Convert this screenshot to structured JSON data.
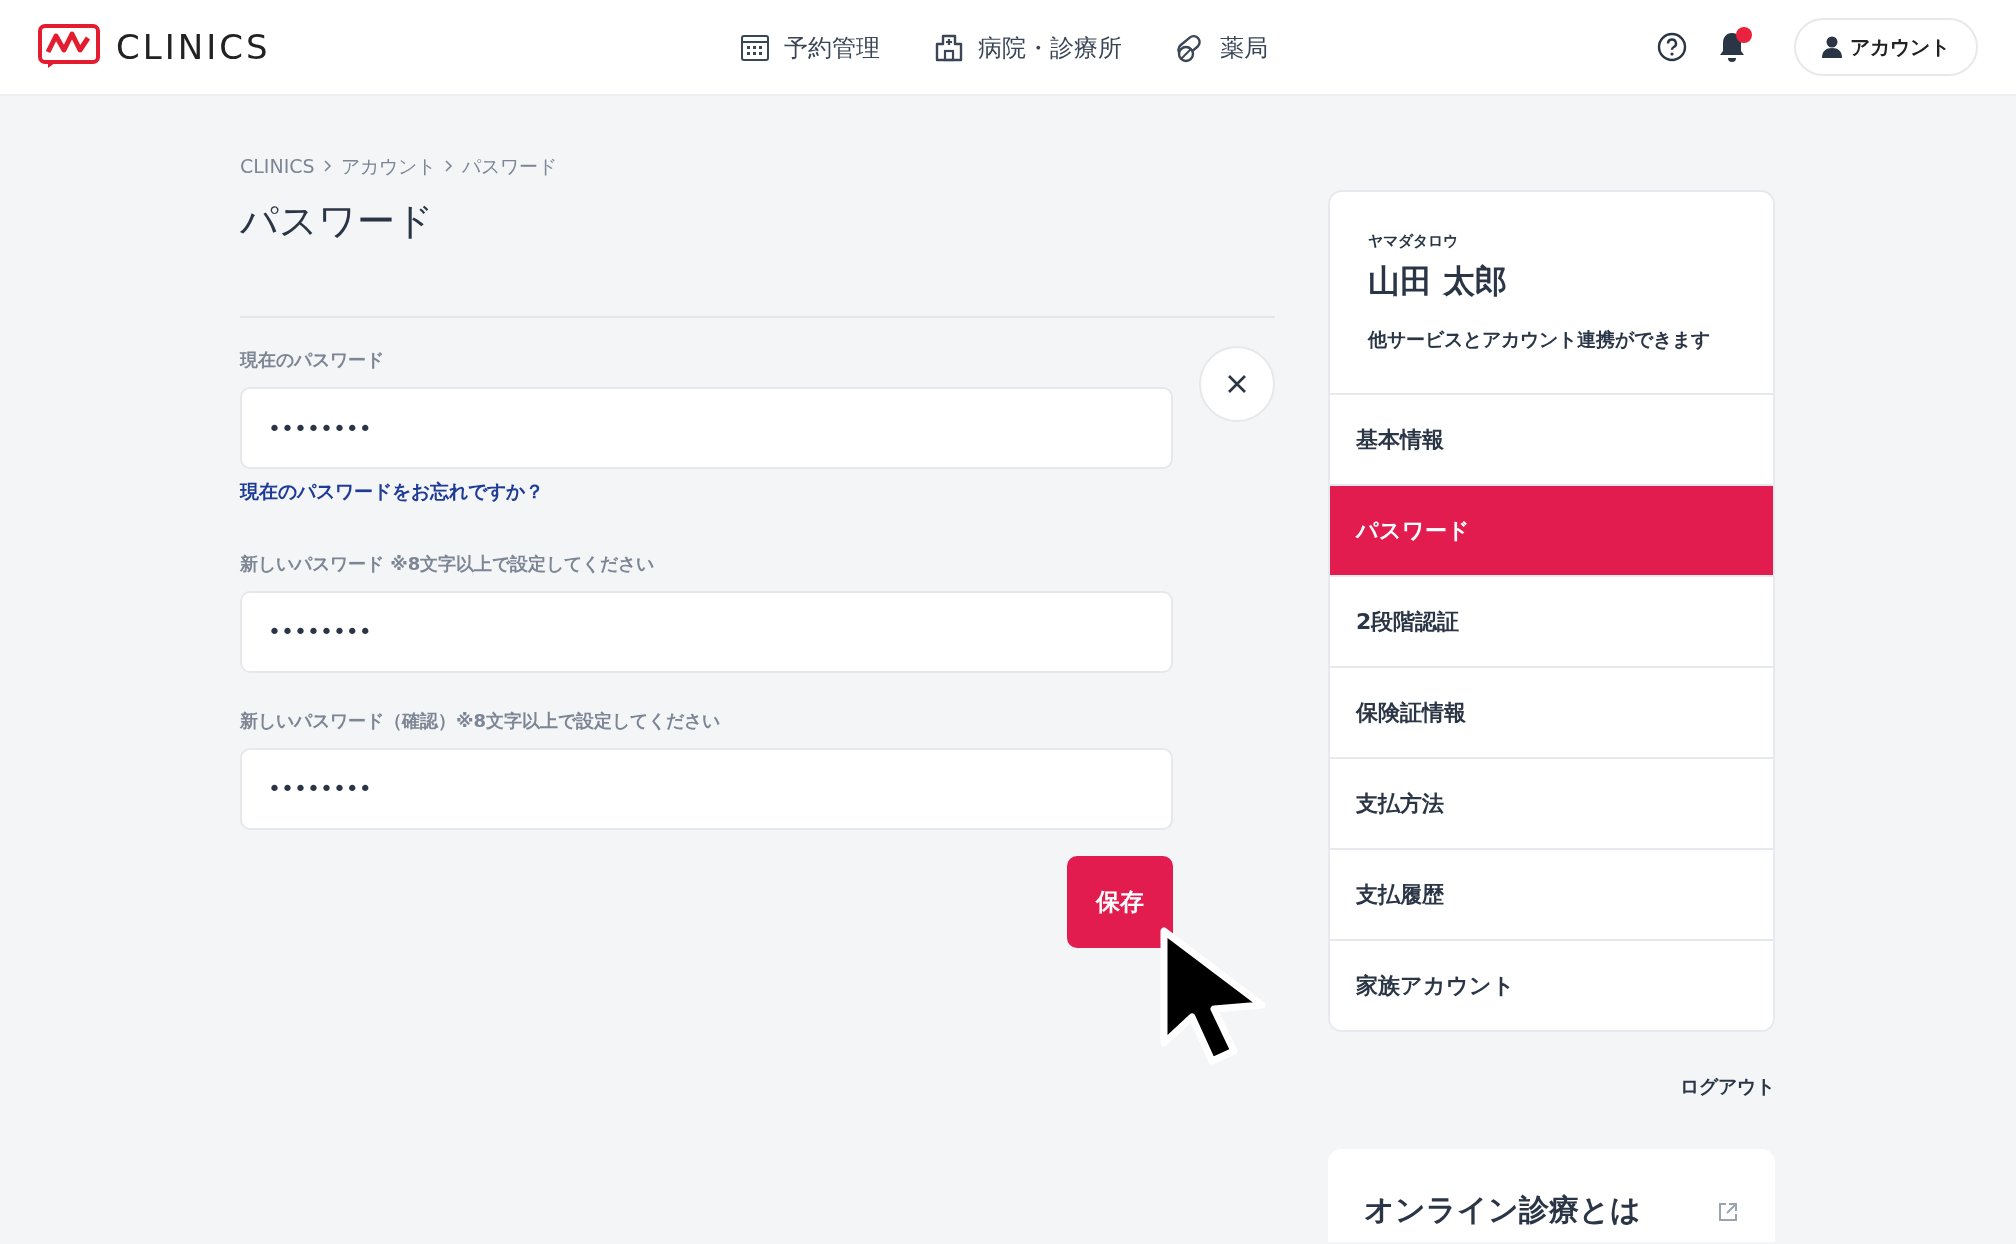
{
  "header": {
    "logo_text": "CLINICS",
    "nav": [
      {
        "label": "予約管理"
      },
      {
        "label": "病院・診療所"
      },
      {
        "label": "薬局"
      }
    ],
    "has_notification": true,
    "account_button": "アカウント"
  },
  "breadcrumb": [
    "CLINICS",
    "アカウント",
    "パスワード"
  ],
  "page_title": "パスワード",
  "fields": [
    {
      "label": "現在のパスワード",
      "value": "••••••••"
    },
    {
      "label": "新しいパスワード ※8文字以上で設定してください",
      "value": "••••••••"
    },
    {
      "label": "新しいパスワード（確認）※8文字以上で設定してください",
      "value": "••••••••"
    }
  ],
  "forgot_link": "現在のパスワードをお忘れですか？",
  "save_button": "保存",
  "profile": {
    "kana": "ヤマダタロウ",
    "name": "山田 太郎",
    "description": "他サービスとアカウント連携ができます"
  },
  "menu": [
    {
      "label": "基本情報",
      "selected": false
    },
    {
      "label": "パスワード",
      "selected": true
    },
    {
      "label": "2段階認証",
      "selected": false
    },
    {
      "label": "保険証情報",
      "selected": false
    },
    {
      "label": "支払方法",
      "selected": false
    },
    {
      "label": "支払履歴",
      "selected": false
    },
    {
      "label": "家族アカウント",
      "selected": false
    }
  ],
  "logout": "ログアウト",
  "info_card": {
    "title": "オンライン診療とは"
  }
}
